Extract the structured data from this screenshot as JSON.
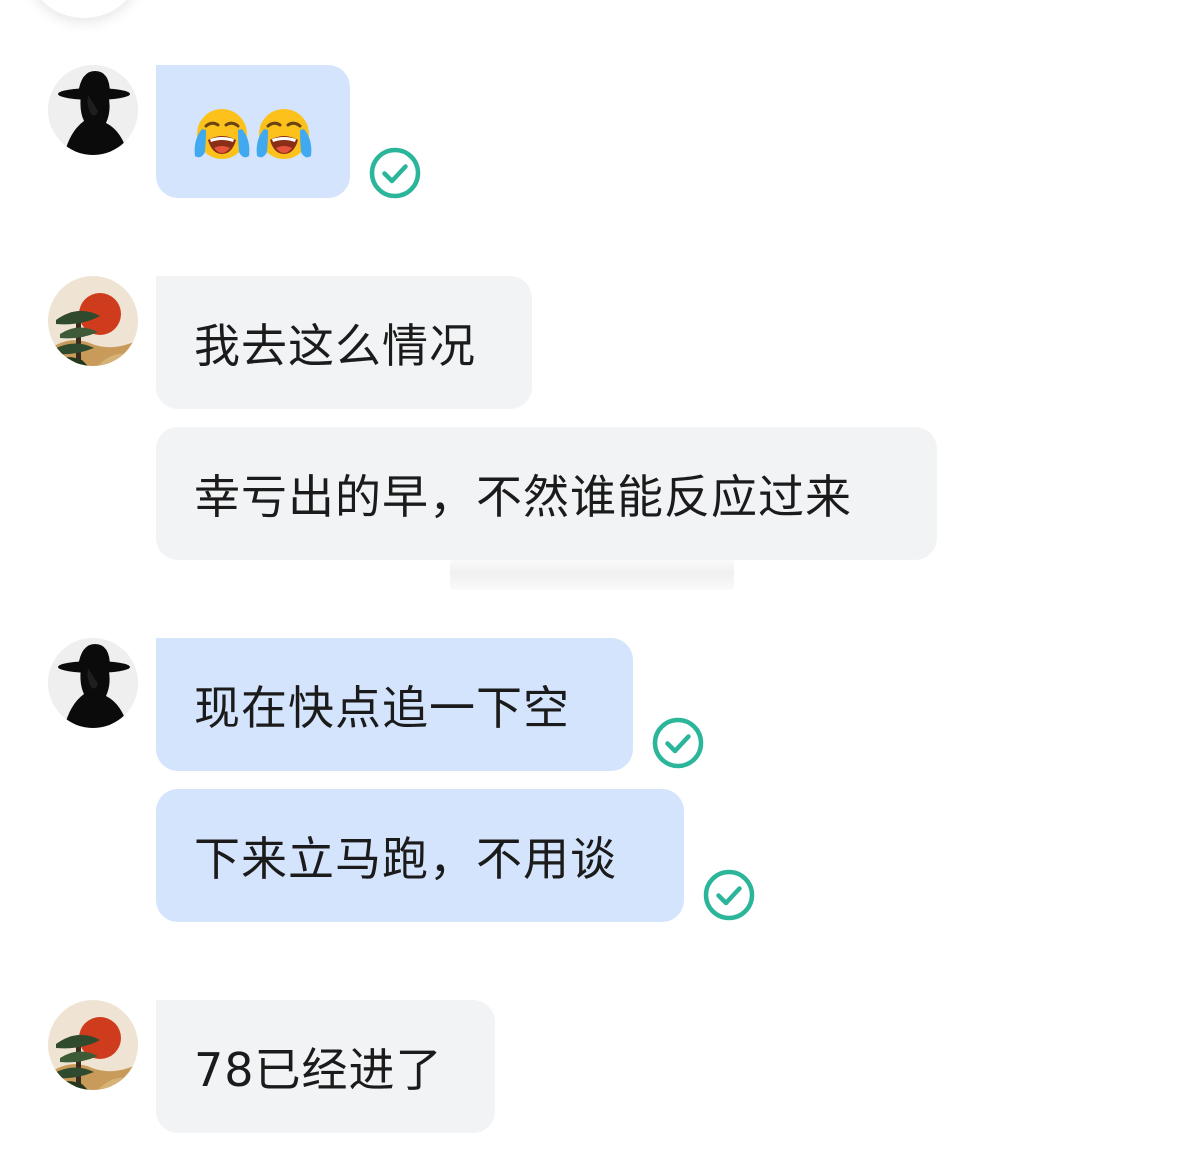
{
  "chat": {
    "messages": [
      {
        "sender": "self",
        "content": [
          "loudly-crying-face-emoji",
          "loudly-crying-face-emoji"
        ],
        "status": "read"
      },
      {
        "sender": "other",
        "text": "我去这么情况"
      },
      {
        "sender": "other",
        "text": "幸亏出的早，不然谁能反应过来"
      },
      {
        "sender": "self",
        "text": "现在快点追一下空",
        "status": "read"
      },
      {
        "sender": "self",
        "text": "下来立马跑，不用谈",
        "status": "read"
      },
      {
        "sender": "other",
        "text": "78已经进了"
      }
    ]
  },
  "colors": {
    "self_bubble": "#d4e4fd",
    "other_bubble": "#f2f3f5",
    "read_check": "#2bb59a",
    "text": "#1b1b1b"
  },
  "icons": {
    "self_avatar": "black-hat-silhouette-avatar",
    "other_avatar": "pine-and-red-sun-avatar",
    "read_status": "check-circle-icon"
  }
}
